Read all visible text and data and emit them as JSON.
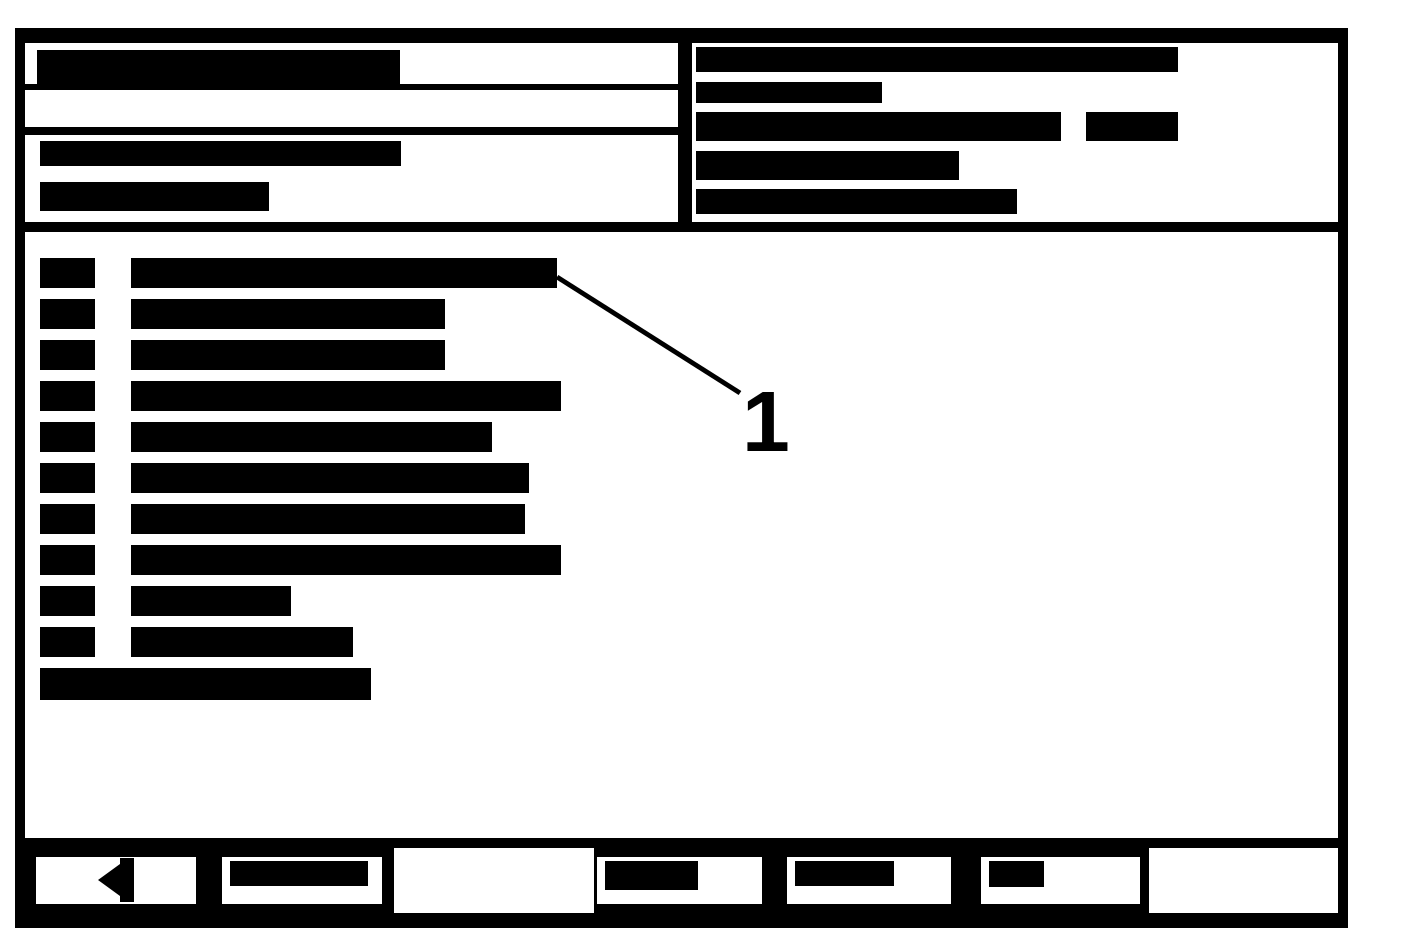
{
  "header": {
    "left_panel": {
      "title": {
        "redacted": true
      },
      "lines": [
        {
          "redacted": true
        },
        {
          "redacted": true
        }
      ]
    },
    "right_panel": {
      "lines": [
        {
          "redacted": true
        },
        {
          "redacted": true
        },
        {
          "redacted": true,
          "value": {
            "redacted": true
          }
        },
        {
          "redacted": true
        },
        {
          "redacted": true
        }
      ]
    }
  },
  "list": {
    "rows": [
      {
        "number": {
          "redacted": true
        },
        "label": {
          "redacted": true
        }
      },
      {
        "number": {
          "redacted": true
        },
        "label": {
          "redacted": true
        }
      },
      {
        "number": {
          "redacted": true
        },
        "label": {
          "redacted": true
        }
      },
      {
        "number": {
          "redacted": true
        },
        "label": {
          "redacted": true
        }
      },
      {
        "number": {
          "redacted": true
        },
        "label": {
          "redacted": true
        }
      },
      {
        "number": {
          "redacted": true
        },
        "label": {
          "redacted": true
        }
      },
      {
        "number": {
          "redacted": true
        },
        "label": {
          "redacted": true
        }
      },
      {
        "number": {
          "redacted": true
        },
        "label": {
          "redacted": true
        }
      },
      {
        "number": {
          "redacted": true
        },
        "label": {
          "redacted": true
        }
      },
      {
        "number": {
          "redacted": true
        },
        "label": {
          "redacted": true
        }
      }
    ],
    "footer": {
      "redacted": true
    }
  },
  "callout": {
    "label": "1"
  },
  "softkeys": [
    {
      "kind": "arrow"
    },
    {
      "kind": "label",
      "redacted": true
    },
    {
      "kind": "blank"
    },
    {
      "kind": "label",
      "redacted": true
    },
    {
      "kind": "label",
      "redacted": true
    },
    {
      "kind": "label",
      "redacted": true
    },
    {
      "kind": "blank"
    }
  ]
}
